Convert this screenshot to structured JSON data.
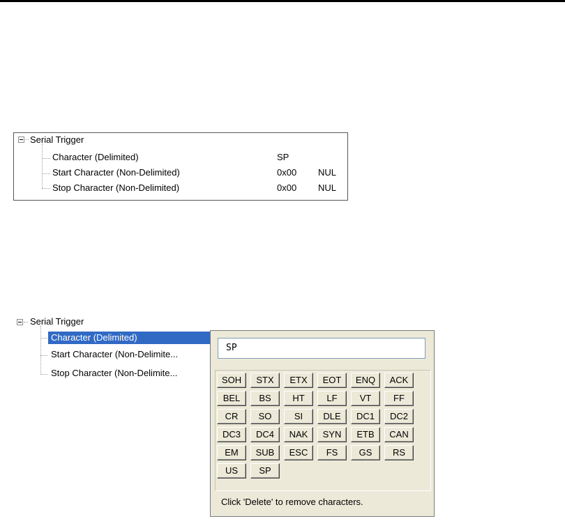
{
  "top_tree": {
    "root_label": "Serial Trigger",
    "rows": [
      {
        "label": "Character (Delimited)",
        "value": "SP",
        "name": ""
      },
      {
        "label": "Start Character (Non-Delimited)",
        "value": "0x00",
        "name": "NUL"
      },
      {
        "label": "Stop Character (Non-Delimited)",
        "value": "0x00",
        "name": "NUL"
      }
    ]
  },
  "bottom_tree": {
    "root_label": "Serial Trigger",
    "rows": [
      {
        "label": "Character (Delimited)",
        "selected": true
      },
      {
        "label": "Start Character (Non-Delimite..."
      },
      {
        "label": "Stop Character (Non-Delimite..."
      }
    ]
  },
  "picker": {
    "input_value": "SP",
    "keys": [
      [
        "SOH",
        "STX",
        "ETX",
        "EOT",
        "ENQ",
        "ACK"
      ],
      [
        "BEL",
        "BS",
        "HT",
        "LF",
        "VT",
        "FF"
      ],
      [
        "CR",
        "SO",
        "SI",
        "DLE",
        "DC1",
        "DC2"
      ],
      [
        "DC3",
        "DC4",
        "NAK",
        "SYN",
        "ETB",
        "CAN"
      ],
      [
        "EM",
        "SUB",
        "ESC",
        "FS",
        "GS",
        "RS"
      ],
      [
        "US",
        "SP"
      ]
    ],
    "hint": "Click 'Delete' to remove characters."
  },
  "colors": {
    "selection": "#316ac5",
    "panel_face": "#ece9d8"
  }
}
